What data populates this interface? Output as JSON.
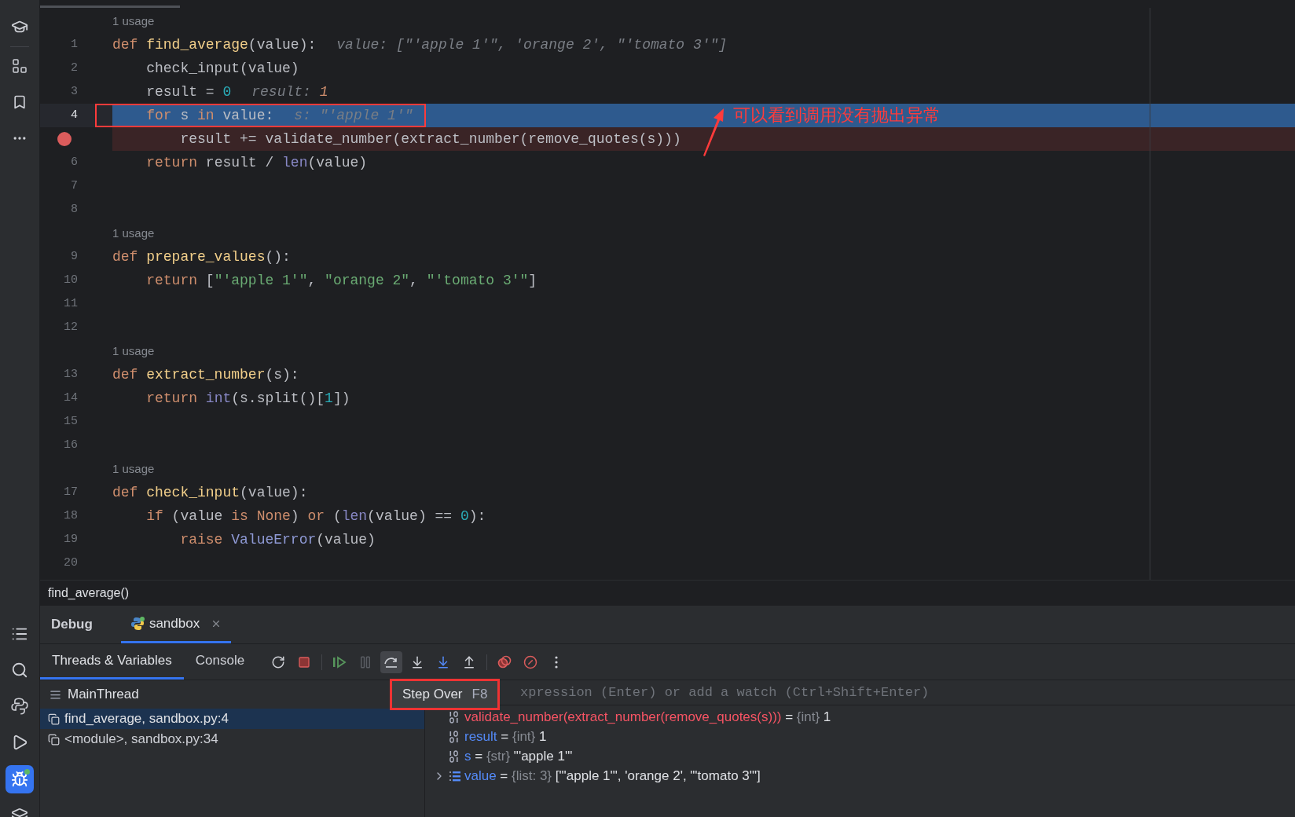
{
  "editor": {
    "lines": [
      {
        "kind": "usage",
        "text": "1 usage"
      },
      {
        "kind": "code",
        "number": "1",
        "selected": false,
        "breakpoint": false,
        "boxed": false,
        "tokens": [
          {
            "kind": "kw",
            "text": "def"
          },
          {
            "kind": "fn",
            "text": " find_average"
          },
          {
            "kind": "plain",
            "text": "(value):"
          }
        ],
        "hint": [
          {
            "kind": "hint",
            "text": "value: [\"'apple 1'\", 'orange 2', \"'tomato 3'\"]"
          }
        ]
      },
      {
        "kind": "code",
        "number": "2",
        "selected": false,
        "breakpoint": false,
        "boxed": false,
        "tokens": [
          {
            "kind": "plain",
            "text": "    check_input(value)"
          }
        ]
      },
      {
        "kind": "code",
        "number": "3",
        "selected": false,
        "breakpoint": false,
        "boxed": false,
        "tokens": [
          {
            "kind": "plain",
            "text": "    result = "
          },
          {
            "kind": "num",
            "text": "0"
          }
        ],
        "hint": [
          {
            "kind": "hint",
            "text": "result: "
          },
          {
            "kind": "hintval",
            "text": "1"
          }
        ]
      },
      {
        "kind": "code",
        "number": "4",
        "selected": true,
        "breakpoint": false,
        "boxed": true,
        "tokens": [
          {
            "kind": "kw",
            "text": "    for"
          },
          {
            "kind": "plain",
            "text": " s "
          },
          {
            "kind": "kw",
            "text": "in"
          },
          {
            "kind": "plain",
            "text": " value:"
          }
        ],
        "hint": [
          {
            "kind": "hint",
            "text": "s: \"'apple 1'\""
          }
        ]
      },
      {
        "kind": "code",
        "selected": false,
        "breakpoint": true,
        "boxed": false,
        "tokens": [
          {
            "kind": "plain",
            "text": "        result += validate_number(extract_number(remove_quotes(s)))"
          }
        ]
      },
      {
        "kind": "code",
        "number": "6",
        "selected": false,
        "breakpoint": false,
        "boxed": false,
        "tokens": [
          {
            "kind": "kw",
            "text": "    return"
          },
          {
            "kind": "plain",
            "text": " result / "
          },
          {
            "kind": "builtin",
            "text": "len"
          },
          {
            "kind": "plain",
            "text": "(value)"
          }
        ]
      },
      {
        "kind": "code",
        "number": "7",
        "selected": false,
        "breakpoint": false,
        "boxed": false
      },
      {
        "kind": "code",
        "number": "8",
        "selected": false,
        "breakpoint": false,
        "boxed": false
      },
      {
        "kind": "usage",
        "text": "1 usage"
      },
      {
        "kind": "code",
        "number": "9",
        "selected": false,
        "breakpoint": false,
        "boxed": false,
        "tokens": [
          {
            "kind": "kw",
            "text": "def"
          },
          {
            "kind": "fn",
            "text": " prepare_values"
          },
          {
            "kind": "plain",
            "text": "():"
          }
        ]
      },
      {
        "kind": "code",
        "number": "10",
        "selected": false,
        "breakpoint": false,
        "boxed": false,
        "tokens": [
          {
            "kind": "kw",
            "text": "    return"
          },
          {
            "kind": "plain",
            "text": " ["
          },
          {
            "kind": "str",
            "text": "\"'apple 1'\""
          },
          {
            "kind": "plain",
            "text": ", "
          },
          {
            "kind": "str",
            "text": "\"orange 2\""
          },
          {
            "kind": "plain",
            "text": ", "
          },
          {
            "kind": "str",
            "text": "\"'tomato 3'\""
          },
          {
            "kind": "plain",
            "text": "]"
          }
        ]
      },
      {
        "kind": "code",
        "number": "11",
        "selected": false,
        "breakpoint": false,
        "boxed": false
      },
      {
        "kind": "code",
        "number": "12",
        "selected": false,
        "breakpoint": false,
        "boxed": false
      },
      {
        "kind": "usage",
        "text": "1 usage"
      },
      {
        "kind": "code",
        "number": "13",
        "selected": false,
        "breakpoint": false,
        "boxed": false,
        "tokens": [
          {
            "kind": "kw",
            "text": "def"
          },
          {
            "kind": "fn",
            "text": " extract_number"
          },
          {
            "kind": "plain",
            "text": "(s):"
          }
        ]
      },
      {
        "kind": "code",
        "number": "14",
        "selected": false,
        "breakpoint": false,
        "boxed": false,
        "tokens": [
          {
            "kind": "kw",
            "text": "    return"
          },
          {
            "kind": "builtin",
            "text": " int"
          },
          {
            "kind": "plain",
            "text": "(s.split()["
          },
          {
            "kind": "num",
            "text": "1"
          },
          {
            "kind": "plain",
            "text": "])"
          }
        ]
      },
      {
        "kind": "code",
        "number": "15",
        "selected": false,
        "breakpoint": false,
        "boxed": false
      },
      {
        "kind": "code",
        "number": "16",
        "selected": false,
        "breakpoint": false,
        "boxed": false
      },
      {
        "kind": "usage",
        "text": "1 usage"
      },
      {
        "kind": "code",
        "number": "17",
        "selected": false,
        "breakpoint": false,
        "boxed": false,
        "tokens": [
          {
            "kind": "kw",
            "text": "def"
          },
          {
            "kind": "fn",
            "text": " check_input"
          },
          {
            "kind": "plain",
            "text": "(value):"
          }
        ]
      },
      {
        "kind": "code",
        "number": "18",
        "selected": false,
        "breakpoint": false,
        "boxed": false,
        "tokens": [
          {
            "kind": "kw",
            "text": "    if"
          },
          {
            "kind": "plain",
            "text": " (value "
          },
          {
            "kind": "kw",
            "text": "is"
          },
          {
            "kind": "kw",
            "text": " None"
          },
          {
            "kind": "plain",
            "text": ") "
          },
          {
            "kind": "kw",
            "text": "or"
          },
          {
            "kind": "plain",
            "text": " ("
          },
          {
            "kind": "builtin",
            "text": "len"
          },
          {
            "kind": "plain",
            "text": "(value) == "
          },
          {
            "kind": "num",
            "text": "0"
          },
          {
            "kind": "plain",
            "text": "):"
          }
        ]
      },
      {
        "kind": "code",
        "number": "19",
        "selected": false,
        "breakpoint": false,
        "boxed": false,
        "tokens": [
          {
            "kind": "kw",
            "text": "        raise"
          },
          {
            "kind": "cls",
            "text": " ValueError"
          },
          {
            "kind": "plain",
            "text": "(value)"
          }
        ]
      },
      {
        "kind": "code",
        "number": "20",
        "selected": false,
        "breakpoint": false,
        "boxed": false
      }
    ],
    "annotation": {
      "text": "可以看到调用没有抛出异常"
    }
  },
  "breadcrumb": "find_average()",
  "debug": {
    "title": "Debug",
    "tabs": [
      {
        "label": "sandbox",
        "selected": true
      }
    ],
    "subtabs": [
      {
        "label": "Threads & Variables",
        "selected": true
      },
      {
        "label": "Console",
        "selected": false
      }
    ],
    "toolbar": [
      {
        "kind": "rerun",
        "selected": false
      },
      {
        "kind": "stop",
        "selected": false
      },
      {
        "kind": "resume",
        "selected": false
      },
      {
        "kind": "pause",
        "selected": false
      },
      {
        "kind": "step_over",
        "selected": true
      },
      {
        "kind": "step_into",
        "selected": false
      },
      {
        "kind": "step_into_my_code",
        "selected": false
      },
      {
        "kind": "step_out",
        "selected": false
      },
      {
        "kind": "view_breakpoints",
        "selected": false
      },
      {
        "kind": "mute_breakpoints",
        "selected": false
      },
      {
        "kind": "more",
        "selected": false
      }
    ],
    "tooltip": {
      "label": "Step Over",
      "shortcut": "F8",
      "boxed": true
    },
    "thread": "MainThread",
    "frames": [
      {
        "label": "find_average, sandbox.py:4",
        "selected": true
      },
      {
        "label": "<module>, sandbox.py:34",
        "selected": false
      }
    ],
    "watch": {
      "placeholder": "xpression (Enter) or add a watch (Ctrl+Shift+Enter)"
    },
    "variables": [
      {
        "kind": "primitive",
        "returned": true,
        "expandable": false,
        "name": "validate_number(extract_number(remove_quotes(s)))",
        "operator": "=",
        "type": "{int}",
        "value": "1"
      },
      {
        "kind": "primitive",
        "returned": false,
        "expandable": false,
        "name": "result",
        "operator": "=",
        "type": "{int}",
        "value": "1"
      },
      {
        "kind": "primitive",
        "returned": false,
        "expandable": false,
        "name": "s",
        "operator": "=",
        "type": "{str}",
        "value": "\"'apple 1'\""
      },
      {
        "kind": "list",
        "returned": false,
        "expandable": true,
        "name": "value",
        "operator": "=",
        "type": "{list: 3}",
        "value": "[\"'apple 1'\", 'orange 2', \"'tomato 3'\"]"
      }
    ]
  }
}
